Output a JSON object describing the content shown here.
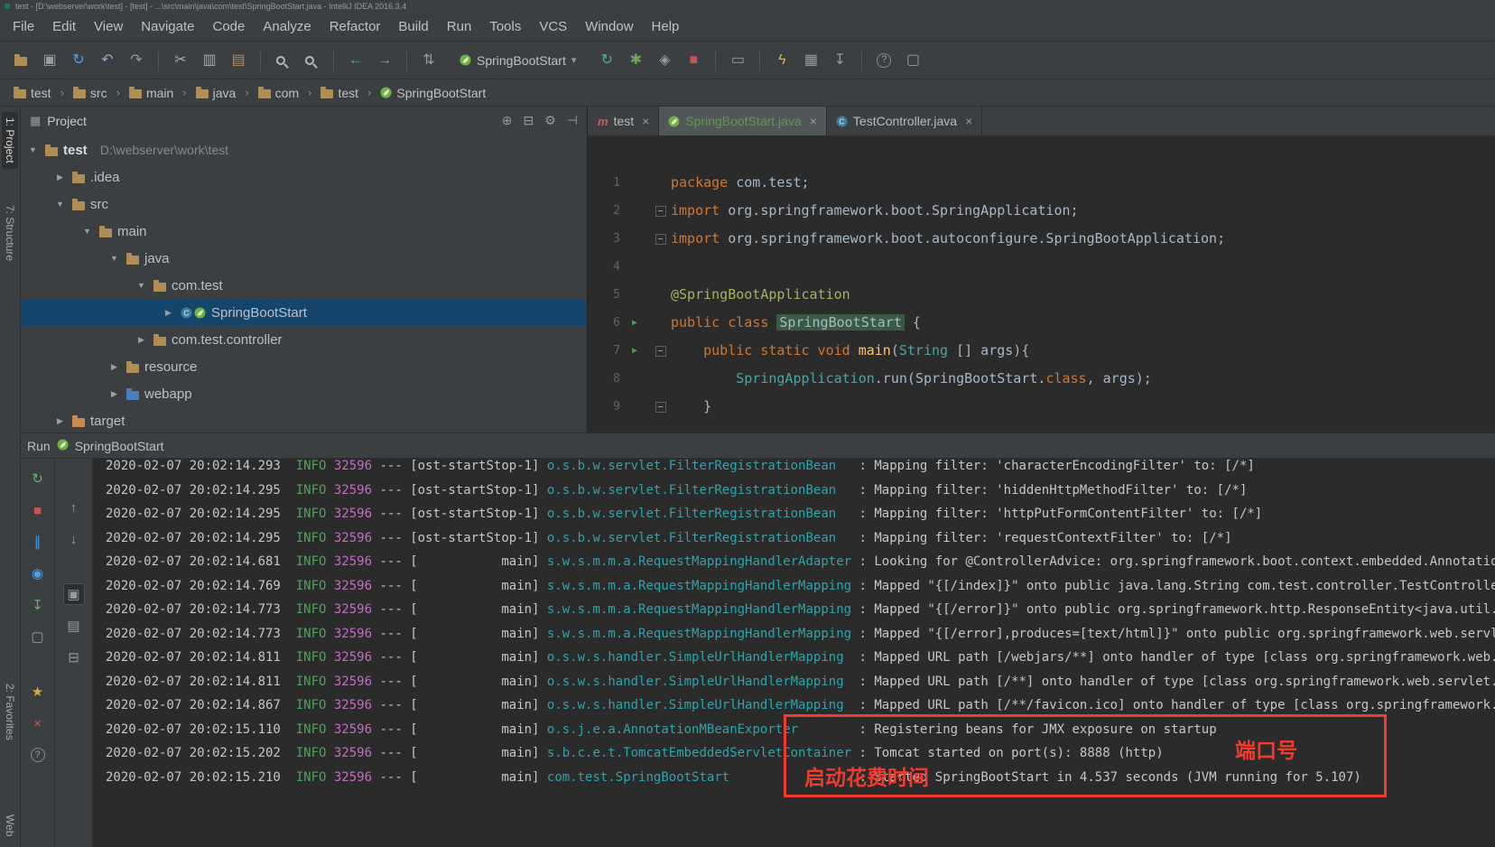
{
  "window": {
    "title": "test - [D:\\webserver\\work\\test] - [test] - ...\\src\\main\\java\\com\\test\\SpringBootStart.java - IntelliJ IDEA 2016.3.4"
  },
  "colors": {
    "bg_editor": "#2b2b2b",
    "bg_panel": "#3c3f41",
    "selection_blue": "#15456b",
    "keyword_orange": "#cc7832",
    "annotation_yellow": "#a9b25d",
    "function_yellow": "#ffc66d",
    "classref_teal": "#4ea5a0",
    "text_code": "#a9b7c6",
    "log_info_green": "#4fa35a",
    "log_pid_magenta": "#c46cc4",
    "log_logger_teal": "#2fa3ab",
    "log_text": "#c6c6c6",
    "annotation_red": "#f23a2e",
    "spring_green": "#6db33f",
    "run_green": "#499c54",
    "stop_red": "#c75450",
    "tab_modified_green": "#629755"
  },
  "menu": {
    "items": [
      "File",
      "Edit",
      "View",
      "Navigate",
      "Code",
      "Analyze",
      "Refactor",
      "Build",
      "Run",
      "Tools",
      "VCS",
      "Window",
      "Help"
    ]
  },
  "toolbar": {
    "run_config": {
      "label": "SpringBootStart"
    },
    "buttons": [
      {
        "name": "open",
        "icon": "folder"
      },
      {
        "name": "save-all",
        "glyph": "▣",
        "color": "#9a9a9a"
      },
      {
        "name": "synchronize",
        "glyph": "↻",
        "color": "#4f9ee3"
      },
      {
        "name": "undo",
        "glyph": "↶",
        "color": "#b09ccd"
      },
      {
        "name": "redo",
        "glyph": "↷",
        "color": "#9a9a9a"
      },
      {
        "sep": true
      },
      {
        "name": "cut",
        "glyph": "✂",
        "color": "#a8a8a8"
      },
      {
        "name": "copy",
        "glyph": "▥",
        "color": "#a8a8a8"
      },
      {
        "name": "paste",
        "glyph": "▤",
        "color": "#b08d57"
      },
      {
        "sep": true
      },
      {
        "name": "find",
        "icon": "magnifier"
      },
      {
        "name": "replace",
        "icon": "magnifier"
      },
      {
        "sep": true
      },
      {
        "name": "back",
        "glyph": "←",
        "color": "#56a8a2"
      },
      {
        "name": "forward",
        "glyph": "→",
        "color": "#9a9a9a"
      },
      {
        "sep": true
      },
      {
        "name": "compare",
        "glyph": "⇅",
        "color": "#9a9a9a"
      },
      {
        "runconfig": true
      },
      {
        "name": "run",
        "glyph": "↻",
        "color": "#56a8a2"
      },
      {
        "name": "debug",
        "glyph": "✱",
        "color": "#6ba65c"
      },
      {
        "name": "coverage",
        "glyph": "◈",
        "color": "#9a9a9a"
      },
      {
        "name": "stop",
        "glyph": "■",
        "color": "#c75450"
      },
      {
        "sep": true
      },
      {
        "name": "console",
        "glyph": "▭",
        "color": "#9a9a9a"
      },
      {
        "sep": true
      },
      {
        "name": "power",
        "glyph": "ϟ",
        "color": "#d3b54a"
      },
      {
        "name": "layout",
        "glyph": "▦",
        "color": "#9a9a9a"
      },
      {
        "name": "update",
        "glyph": "↧",
        "color": "#9a9a9a"
      },
      {
        "sep": true
      },
      {
        "name": "help",
        "glyph": "?",
        "color": "#9a9a9a",
        "round": true
      },
      {
        "name": "window",
        "glyph": "▢",
        "color": "#9a9a9a"
      }
    ]
  },
  "navbar": {
    "items": [
      {
        "label": "test",
        "icon": "folder"
      },
      {
        "label": "src",
        "icon": "folder"
      },
      {
        "label": "main",
        "icon": "folder"
      },
      {
        "label": "java",
        "icon": "folder"
      },
      {
        "label": "com",
        "icon": "folder"
      },
      {
        "label": "test",
        "icon": "folder"
      },
      {
        "label": "SpringBootStart",
        "icon": "spring"
      }
    ]
  },
  "tool_stripes": {
    "left_top": [
      {
        "label": "1: Project",
        "active": true
      },
      {
        "label": "7: Structure",
        "active": false
      }
    ],
    "left_bottom": [
      {
        "label": "2: Favorites",
        "active": false
      },
      {
        "label": "Web",
        "active": false
      }
    ]
  },
  "project_panel": {
    "title": "Project",
    "header_buttons": [
      "locate",
      "collapse-all",
      "settings",
      "hide"
    ],
    "tree": [
      {
        "label": "test",
        "path": "D:\\webserver\\work\\test",
        "icon": "folder",
        "indent": 0,
        "arrow": "expanded",
        "bold": true,
        "selected": false
      },
      {
        "label": ".idea",
        "icon": "folder",
        "indent": 1,
        "arrow": "collapsed",
        "selected": false
      },
      {
        "label": "src",
        "icon": "folder",
        "indent": 1,
        "arrow": "expanded",
        "selected": false
      },
      {
        "label": "main",
        "icon": "folder",
        "indent": 2,
        "arrow": "expanded",
        "selected": false
      },
      {
        "label": "java",
        "icon": "folder",
        "indent": 3,
        "arrow": "expanded",
        "selected": false
      },
      {
        "label": "com.test",
        "icon": "folder",
        "indent": 4,
        "arrow": "expanded",
        "selected": false
      },
      {
        "label": "SpringBootStart",
        "icon": "spring-class",
        "indent": 5,
        "arrow": "collapsed",
        "selected": true
      },
      {
        "label": "com.test.controller",
        "icon": "folder",
        "indent": 4,
        "arrow": "collapsed",
        "selected": false
      },
      {
        "label": "resource",
        "icon": "folder",
        "indent": 3,
        "arrow": "collapsed",
        "selected": false
      },
      {
        "label": "webapp",
        "icon": "folder-web",
        "indent": 3,
        "arrow": "collapsed",
        "selected": false
      },
      {
        "label": "target",
        "icon": "folder-excluded",
        "indent": 1,
        "arrow": "collapsed",
        "selected": false
      }
    ]
  },
  "editor": {
    "tabs": [
      {
        "label": "test",
        "icon": "maven",
        "active": false,
        "modified": false
      },
      {
        "label": "SpringBootStart.java",
        "icon": "spring",
        "active": true,
        "modified": true
      },
      {
        "label": "TestController.java",
        "icon": "class",
        "active": false,
        "modified": false
      }
    ],
    "lines": [
      {
        "num": "1",
        "run": false,
        "fold": false,
        "tokens": [
          [
            "kw",
            "package "
          ],
          [
            "pl",
            "com.test;"
          ]
        ]
      },
      {
        "num": "2",
        "run": false,
        "fold": true,
        "tokens": [
          [
            "kw",
            "import "
          ],
          [
            "pl",
            "org.springframework.boot.SpringApplication;"
          ]
        ]
      },
      {
        "num": "3",
        "run": false,
        "fold": true,
        "tokens": [
          [
            "kw",
            "import "
          ],
          [
            "pl",
            "org.springframework.boot.autoconfigure.SpringBootApplication;"
          ]
        ]
      },
      {
        "num": "4",
        "run": false,
        "fold": false,
        "tokens": []
      },
      {
        "num": "5",
        "run": false,
        "fold": false,
        "tokens": [
          [
            "ann",
            "@SpringBootApplication"
          ]
        ]
      },
      {
        "num": "6",
        "run": true,
        "fold": false,
        "tokens": [
          [
            "kw",
            "public class "
          ],
          [
            "hl",
            "SpringBootStart"
          ],
          [
            "pl",
            " {"
          ]
        ]
      },
      {
        "num": "7",
        "run": true,
        "fold": true,
        "tokens": [
          [
            "pl",
            "    "
          ],
          [
            "kw",
            "public static void "
          ],
          [
            "fn",
            "main"
          ],
          [
            "pl",
            "("
          ],
          [
            "cls",
            "String"
          ],
          [
            "pl",
            " [] args){"
          ]
        ]
      },
      {
        "num": "8",
        "run": false,
        "fold": false,
        "tokens": [
          [
            "pl",
            "        "
          ],
          [
            "cls",
            "SpringApplication"
          ],
          [
            "pl",
            ".run("
          ],
          [
            "pl",
            "SpringBootStart."
          ],
          [
            "kw",
            "class"
          ],
          [
            "pl",
            ", args);"
          ]
        ]
      },
      {
        "num": "9",
        "run": false,
        "fold": true,
        "tokens": [
          [
            "pl",
            "    }"
          ]
        ]
      }
    ]
  },
  "run_panel": {
    "label": "Run",
    "config": "SpringBootStart",
    "toolbar_main": [
      {
        "name": "rerun",
        "glyph": "↻",
        "color": "#64b467"
      },
      {
        "name": "stop",
        "glyph": "■",
        "color": "#c75450"
      },
      {
        "name": "pause-output",
        "glyph": "∥",
        "color": "#4f9ee3"
      },
      {
        "name": "thread-dump",
        "glyph": "◉",
        "color": "#4f9ee3"
      },
      {
        "name": "restore-layout",
        "glyph": "↧",
        "color": "#64b467"
      },
      {
        "name": "show-console",
        "glyph": "▢",
        "color": "#9a9a9a"
      },
      {
        "name": "pin",
        "glyph": "★",
        "color": "#d8a742",
        "gap": true
      },
      {
        "name": "close",
        "glyph": "×",
        "color": "#c75450"
      },
      {
        "name": "help",
        "glyph": "?",
        "color": "#9a9a9a",
        "round": true
      }
    ],
    "toolbar_secondary": [
      {
        "name": "prev-occurrence",
        "glyph": "↑",
        "color": "#9a9a9a"
      },
      {
        "name": "next-occurrence",
        "glyph": "↓",
        "color": "#9a9a9a"
      },
      {
        "name": "soft-wrap",
        "glyph": "▣",
        "color": "#9a9a9a",
        "selected": true,
        "gap": true
      },
      {
        "name": "print",
        "glyph": "▤",
        "color": "#9a9a9a"
      },
      {
        "name": "clear-all",
        "glyph": "⊟",
        "color": "#9a9a9a"
      }
    ],
    "console": {
      "lines": [
        {
          "time": "2020-02-07 20:02:14.293",
          "level": "INFO",
          "pid": "32596",
          "thread": "ost-startStop-1",
          "logger": "o.s.b.w.servlet.FilterRegistrationBean",
          "msg": "Mapping filter: 'characterEncodingFilter' to: [/*]"
        },
        {
          "time": "2020-02-07 20:02:14.295",
          "level": "INFO",
          "pid": "32596",
          "thread": "ost-startStop-1",
          "logger": "o.s.b.w.servlet.FilterRegistrationBean",
          "msg": "Mapping filter: 'hiddenHttpMethodFilter' to: [/*]"
        },
        {
          "time": "2020-02-07 20:02:14.295",
          "level": "INFO",
          "pid": "32596",
          "thread": "ost-startStop-1",
          "logger": "o.s.b.w.servlet.FilterRegistrationBean",
          "msg": "Mapping filter: 'httpPutFormContentFilter' to: [/*]"
        },
        {
          "time": "2020-02-07 20:02:14.295",
          "level": "INFO",
          "pid": "32596",
          "thread": "ost-startStop-1",
          "logger": "o.s.b.w.servlet.FilterRegistrationBean",
          "msg": "Mapping filter: 'requestContextFilter' to: [/*]"
        },
        {
          "time": "2020-02-07 20:02:14.681",
          "level": "INFO",
          "pid": "32596",
          "thread": "main",
          "logger": "s.w.s.m.m.a.RequestMappingHandlerAdapter",
          "msg": "Looking for @ControllerAdvice: org.springframework.boot.context.embedded.AnnotationConfigEmbedded"
        },
        {
          "time": "2020-02-07 20:02:14.769",
          "level": "INFO",
          "pid": "32596",
          "thread": "main",
          "logger": "s.w.s.m.m.a.RequestMappingHandlerMapping",
          "msg": "Mapped \"{[/index]}\" onto public java.lang.String com.test.controller.TestController.index()"
        },
        {
          "time": "2020-02-07 20:02:14.773",
          "level": "INFO",
          "pid": "32596",
          "thread": "main",
          "logger": "s.w.s.m.m.a.RequestMappingHandlerMapping",
          "msg": "Mapped \"{[/error]}\" onto public org.springframework.http.ResponseEntity<java.util.Map<java.lang.S"
        },
        {
          "time": "2020-02-07 20:02:14.773",
          "level": "INFO",
          "pid": "32596",
          "thread": "main",
          "logger": "s.w.s.m.m.a.RequestMappingHandlerMapping",
          "msg": "Mapped \"{[/error],produces=[text/html]}\" onto public org.springframework.web.servlet.ModelAndView"
        },
        {
          "time": "2020-02-07 20:02:14.811",
          "level": "INFO",
          "pid": "32596",
          "thread": "main",
          "logger": "o.s.w.s.handler.SimpleUrlHandlerMapping",
          "msg": "Mapped URL path [/webjars/**] onto handler of type [class org.springframework.web.servlet.resource"
        },
        {
          "time": "2020-02-07 20:02:14.811",
          "level": "INFO",
          "pid": "32596",
          "thread": "main",
          "logger": "o.s.w.s.handler.SimpleUrlHandlerMapping",
          "msg": "Mapped URL path [/**] onto handler of type [class org.springframework.web.servlet.resource.Resourc"
        },
        {
          "time": "2020-02-07 20:02:14.867",
          "level": "INFO",
          "pid": "32596",
          "thread": "main",
          "logger": "o.s.w.s.handler.SimpleUrlHandlerMapping",
          "msg": "Mapped URL path [/**/favicon.ico] onto handler of type [class org.springframework.web.servlet.reso"
        },
        {
          "time": "2020-02-07 20:02:15.110",
          "level": "INFO",
          "pid": "32596",
          "thread": "main",
          "logger": "o.s.j.e.a.AnnotationMBeanExporter",
          "msg": "Registering beans for JMX exposure on startup"
        },
        {
          "time": "2020-02-07 20:02:15.202",
          "level": "INFO",
          "pid": "32596",
          "thread": "main",
          "logger": "s.b.c.e.t.TomcatEmbeddedServletContainer",
          "msg": "Tomcat started on port(s): 8888 (http)"
        },
        {
          "time": "2020-02-07 20:02:15.210",
          "level": "INFO",
          "pid": "32596",
          "thread": "main",
          "logger": "com.test.SpringBootStart",
          "msg": "Started SpringBootStart in 4.537 seconds (JVM running for 5.107)"
        }
      ]
    },
    "annotations": {
      "port_label": "端口号",
      "startup_label": "启动花费时间"
    }
  }
}
